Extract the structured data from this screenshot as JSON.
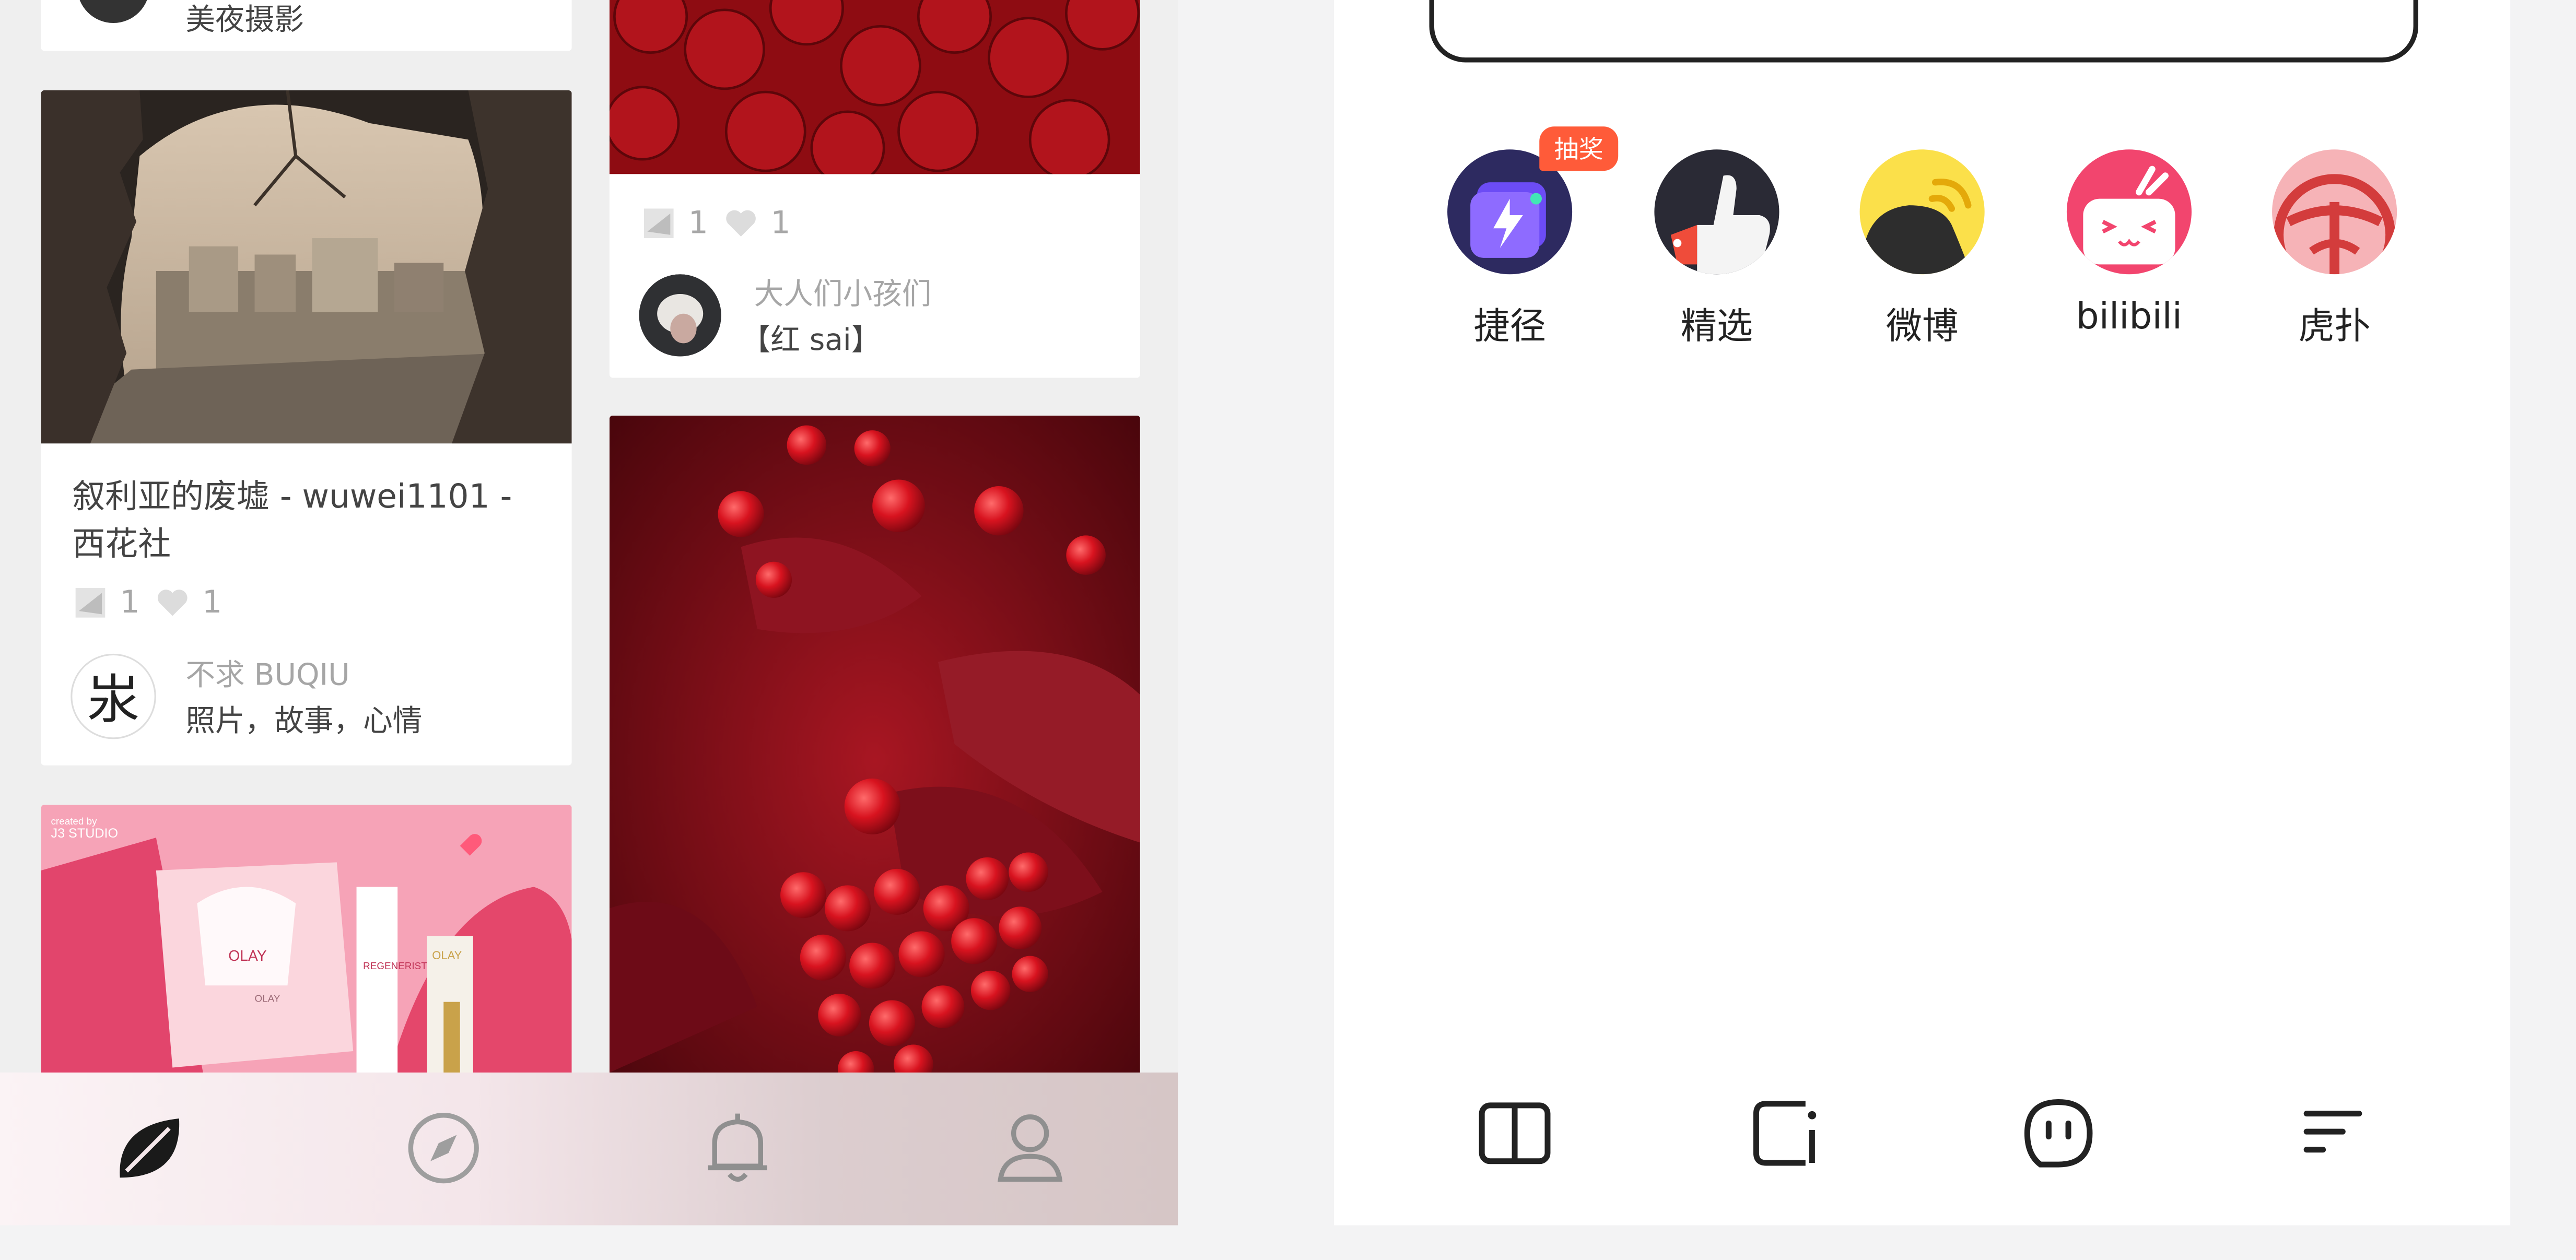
{
  "left_app": {
    "top_card": {
      "desc": "美夜摄影"
    },
    "card_ruins": {
      "title": "叙利亚的废墟 - wuwei1101 - 西花社",
      "collect_count": "1",
      "like_count": "1",
      "author_name": "不求 BUQIU",
      "author_desc": "照片，故事，心情",
      "avatar_char": "汖"
    },
    "card_roses": {
      "collect_count": "1",
      "like_count": "1",
      "author_name": "大人们小孩们",
      "author_desc": "【红 sai】"
    },
    "card_olay": {
      "studio_small": "created by",
      "studio": "J3 STUDIO",
      "brand1": "OLAY",
      "brand2": "OLAY",
      "brand3": "OLAY",
      "product": "REGENERIST"
    },
    "tabs": [
      {
        "name": "home",
        "icon": "leaf-icon"
      },
      {
        "name": "explore",
        "icon": "compass-icon"
      },
      {
        "name": "notifications",
        "icon": "bell-icon"
      },
      {
        "name": "profile",
        "icon": "user-icon"
      }
    ]
  },
  "right_app": {
    "shortcuts": [
      {
        "label": "捷径",
        "icon": "shortcuts-icon",
        "badge": "抽奖"
      },
      {
        "label": "精选",
        "icon": "thumbs-up-icon"
      },
      {
        "label": "微博",
        "icon": "weibo-icon"
      },
      {
        "label": "bilibili",
        "icon": "bilibili-icon"
      },
      {
        "label": "虎扑",
        "icon": "hupu-icon"
      }
    ],
    "nav": [
      {
        "icon": "book-icon"
      },
      {
        "icon": "tab-window-icon"
      },
      {
        "icon": "face-icon"
      },
      {
        "icon": "menu-lines-icon"
      }
    ]
  },
  "colors": {
    "badge": "#ff5b39",
    "shortcut_purple": "#5b3de8",
    "weibo_yellow": "#fbe04a",
    "bilibili_pink": "#f2456e",
    "hupu_pink": "#f6b3b7"
  }
}
